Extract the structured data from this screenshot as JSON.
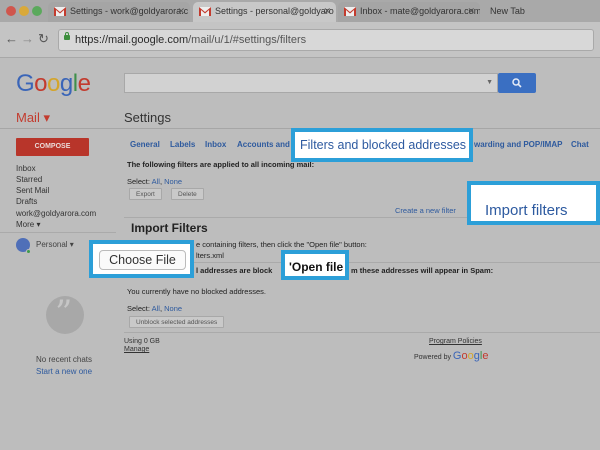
{
  "browser": {
    "traffic_colors": [
      "#d0564d",
      "#d9a93a",
      "#5ba95c"
    ],
    "tabs": [
      {
        "title": "Settings - work@goldyarora.c",
        "active": false,
        "has_gmail_icon": true
      },
      {
        "title": "Settings - personal@goldyaro",
        "active": true,
        "has_gmail_icon": true
      },
      {
        "title": "Inbox - mate@goldyarora.com",
        "active": false,
        "has_gmail_icon": true
      },
      {
        "title": "New Tab",
        "active": false,
        "has_gmail_icon": false
      }
    ],
    "url_host": "https://mail.google.com",
    "url_path": "/mail/u/1/#settings/filters"
  },
  "header": {
    "logo_letters": [
      "G",
      "o",
      "o",
      "g",
      "l",
      "e"
    ],
    "mail_label": "Mail ▾",
    "settings_title": "Settings"
  },
  "left_nav": {
    "compose_label": "COMPOSE",
    "items": [
      "Inbox",
      "Starred",
      "Sent Mail",
      "Drafts",
      "work@goldyarora.com",
      "More ▾"
    ],
    "account_label": "Personal ▾",
    "add_label": "+",
    "no_chats": "No recent chats",
    "start_new": "Start a new one"
  },
  "settings_tabs": [
    "General",
    "Labels",
    "Inbox",
    "Accounts and",
    "warding and POP/IMAP",
    "Chat"
  ],
  "filters": {
    "applied_text": "The following filters are applied to all incoming mail:",
    "select_label": "Select:",
    "select_all": "All",
    "select_none": "None",
    "export_label": "Export",
    "delete_label": "Delete",
    "create_filter_link": "Create a new filter",
    "import_heading": "Import Filters",
    "instructions_tail": "e containing filters, then click the \"Open file\" button:",
    "file_name_tail": "lters.xml",
    "blocked_text_left": "l addresses are block",
    "blocked_text_right": "m these addresses will appear in Spam:",
    "no_blocked": "You currently have no blocked addresses.",
    "unblock_label": "Unblock selected addresses"
  },
  "callouts": {
    "filters_tab": "Filters and blocked addresses",
    "import_filters": "Import filters",
    "choose_file": "Choose File",
    "open_file": "'Open file"
  },
  "footer": {
    "usage": "Using 0 GB",
    "manage": "Manage",
    "program_policies": "Program Policies",
    "powered_by": "Powered by"
  },
  "colors": {
    "accent_blue": "#2c9fd8",
    "link_blue": "#2e5a9e",
    "compose_red": "#b8352a",
    "search_blue": "#3a6fc2"
  },
  "icons": [
    "gmail-icon",
    "back-arrow-icon",
    "forward-arrow-icon",
    "reload-icon",
    "lock-icon",
    "search-icon",
    "hangouts-icon",
    "avatar"
  ]
}
